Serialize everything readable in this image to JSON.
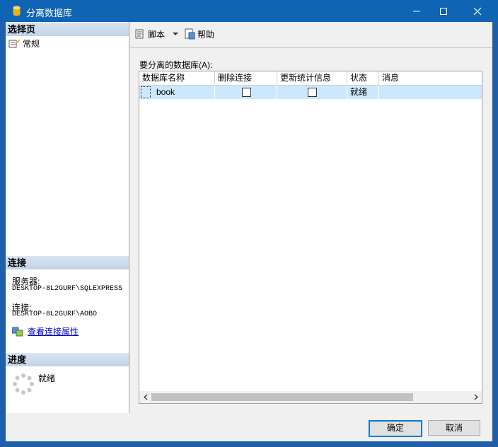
{
  "window": {
    "title": "分离数据库",
    "accent": "#0f64b4"
  },
  "left": {
    "select_page_heading": "选择页",
    "nav_items": [
      {
        "label": "常规",
        "icon": "general-page-icon"
      }
    ],
    "connection_heading": "连接",
    "server_label": "服务器:",
    "server_value": "DESKTOP-8L2GURF\\SQLEXPRESS",
    "connection_label": "连接:",
    "connection_value": "DESKTOP-8L2GURF\\AOBO",
    "view_link": "查看连接属性",
    "progress_heading": "进度",
    "progress_status": "就绪"
  },
  "toolbar": {
    "script_label": "脚本",
    "help_label": "帮助"
  },
  "grid": {
    "caption": "要分离的数据库(A):",
    "columns": [
      "数据库名称",
      "删除连接",
      "更新统计信息",
      "状态",
      "消息"
    ],
    "rows": [
      {
        "name": "book",
        "drop": false,
        "update": false,
        "status": "就绪",
        "message": ""
      }
    ]
  },
  "buttons": {
    "ok": "确定",
    "cancel": "取消"
  }
}
